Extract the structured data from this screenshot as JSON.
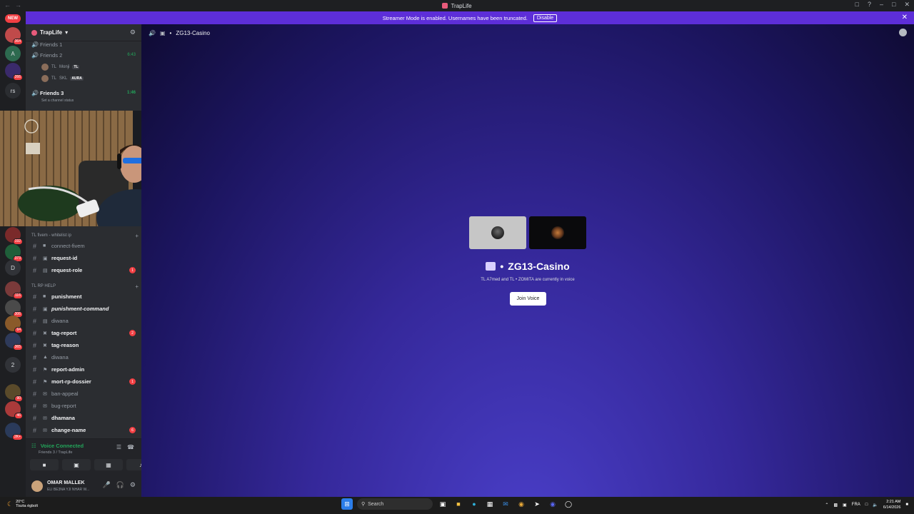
{
  "window": {
    "title": "TrapLife"
  },
  "banner": {
    "message": "Streamer Mode is enabled. Usernames have been truncated.",
    "disable_label": "Disable"
  },
  "rail": {
    "new_label": "NEW",
    "servers": [
      {
        "label": "",
        "badge": "364"
      },
      {
        "label": "A",
        "badge": ""
      },
      {
        "label": "",
        "badge": "266"
      },
      {
        "label": "rs",
        "badge": ""
      },
      {
        "label": "",
        "badge": "192"
      },
      {
        "label": "",
        "badge": "373"
      },
      {
        "label": "D",
        "badge": ""
      },
      {
        "label": "",
        "badge": "116"
      },
      {
        "label": "",
        "badge": "306"
      },
      {
        "label": "",
        "badge": "64"
      },
      {
        "label": "",
        "badge": "365"
      },
      {
        "label": "2",
        "badge": ""
      },
      {
        "label": "",
        "badge": "90"
      },
      {
        "label": "",
        "badge": "46"
      },
      {
        "label": "",
        "badge": "2K+"
      }
    ]
  },
  "guild": {
    "name": "TrapLife"
  },
  "voice_channels": [
    {
      "name": "Friends 1",
      "time": ""
    },
    {
      "name": "Friends 2",
      "time": "6:43"
    },
    {
      "name": "Friends 3",
      "time": "1:46"
    }
  ],
  "members": [
    {
      "prefix": "TL",
      "name": "Monji",
      "tag": "TL"
    },
    {
      "prefix": "TL",
      "name": "SKL",
      "tag": "AURA"
    }
  ],
  "channel_status": "Set a channel status",
  "categories": [
    {
      "name": "TL fivem - whitelist ip"
    },
    {
      "name": "TL RP HELP"
    }
  ],
  "channels_a": [
    {
      "name": "connect-fivem",
      "unread": false,
      "mention": ""
    },
    {
      "name": "request-id",
      "unread": true,
      "mention": ""
    },
    {
      "name": "request-role",
      "unread": true,
      "mention": "1"
    }
  ],
  "channels_b": [
    {
      "name": "punishment",
      "unread": true,
      "mention": ""
    },
    {
      "name": "punishment-command",
      "unread": true,
      "mention": ""
    },
    {
      "name": "diwana",
      "unread": false,
      "mention": ""
    },
    {
      "name": "tag-report",
      "unread": true,
      "mention": "2"
    },
    {
      "name": "tag-reason",
      "unread": true,
      "mention": ""
    },
    {
      "name": "diwana",
      "unread": false,
      "mention": ""
    },
    {
      "name": "report-admin",
      "unread": true,
      "mention": ""
    },
    {
      "name": "mort-rp-dossier",
      "unread": true,
      "mention": "1"
    },
    {
      "name": "ban-appeal",
      "unread": false,
      "mention": ""
    },
    {
      "name": "bug-report",
      "unread": false,
      "mention": ""
    },
    {
      "name": "dhamana",
      "unread": true,
      "mention": ""
    },
    {
      "name": "change-name",
      "unread": true,
      "mention": "6"
    }
  ],
  "voice_panel": {
    "status": "Voice Connected",
    "location": "Friends 3 / TrapLife"
  },
  "user": {
    "name": "OMAR MALLEK",
    "status": "ELI BE3NA YJI NHAR W..."
  },
  "main": {
    "channel_name": "ZG13-Casino",
    "in_voice_names": "TL  A7med and TL  • ZOMITA",
    "in_voice_suffix": "are currently in voice",
    "join_label": "Join Voice"
  },
  "taskbar": {
    "temp": "20°C",
    "weather": "Tiszta égbolt",
    "search_placeholder": "Search",
    "lang": "FRA",
    "time": "2:21 AM",
    "date": "6/14/2026"
  },
  "colors": {
    "accent": "#5d2ed8",
    "voice_green": "#23a55a",
    "mention_red": "#f23f43"
  }
}
